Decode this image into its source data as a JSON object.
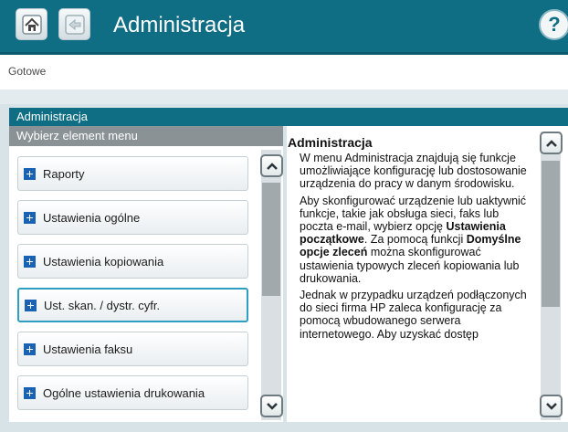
{
  "topbar": {
    "title": "Administracja",
    "icons": {
      "home": "home-icon",
      "back": "back-arrow-icon",
      "help": "help-icon"
    },
    "help_glyph": "?"
  },
  "status": {
    "text": "Gotowe"
  },
  "panel": {
    "header": "Administracja"
  },
  "menu": {
    "header": "Wybierz element menu",
    "items": [
      {
        "label": "Raporty"
      },
      {
        "label": "Ustawienia ogólne"
      },
      {
        "label": "Ustawienia kopiowania"
      },
      {
        "label": "Ust. skan. / dystr. cyfr.",
        "selected": true
      },
      {
        "label": "Ustawienia faksu"
      },
      {
        "label": "Ogólne ustawienia drukowania"
      }
    ]
  },
  "description": {
    "title": "Administracja",
    "p1": "W menu Administracja znajdują się funkcje umożliwiające konfigurację lub dostosowanie urządzenia do pracy w danym środowisku.",
    "p2_a": "Aby skonfigurować urządzenie lub uaktywnić funkcje, takie jak obsługa sieci, faks lub poczta e-mail, wybierz opcję ",
    "p2_b": "Ustawienia początkowe",
    "p2_c": ". Za pomocą funkcji ",
    "p2_d": "Domyślne opcje zleceń",
    "p2_e": " można skonfigurować ustawienia typowych zleceń kopiowania lub drukowania.",
    "p3": "Jednak w przypadku urządzeń podłączonych do sieci firma HP zaleca konfigurację za pomocą wbudowanego serwera internetowego. Aby uzyskać dostęp"
  },
  "colors": {
    "accent": "#0f6d84",
    "plus": "#1a63b4",
    "selection": "#2f9ec3"
  }
}
